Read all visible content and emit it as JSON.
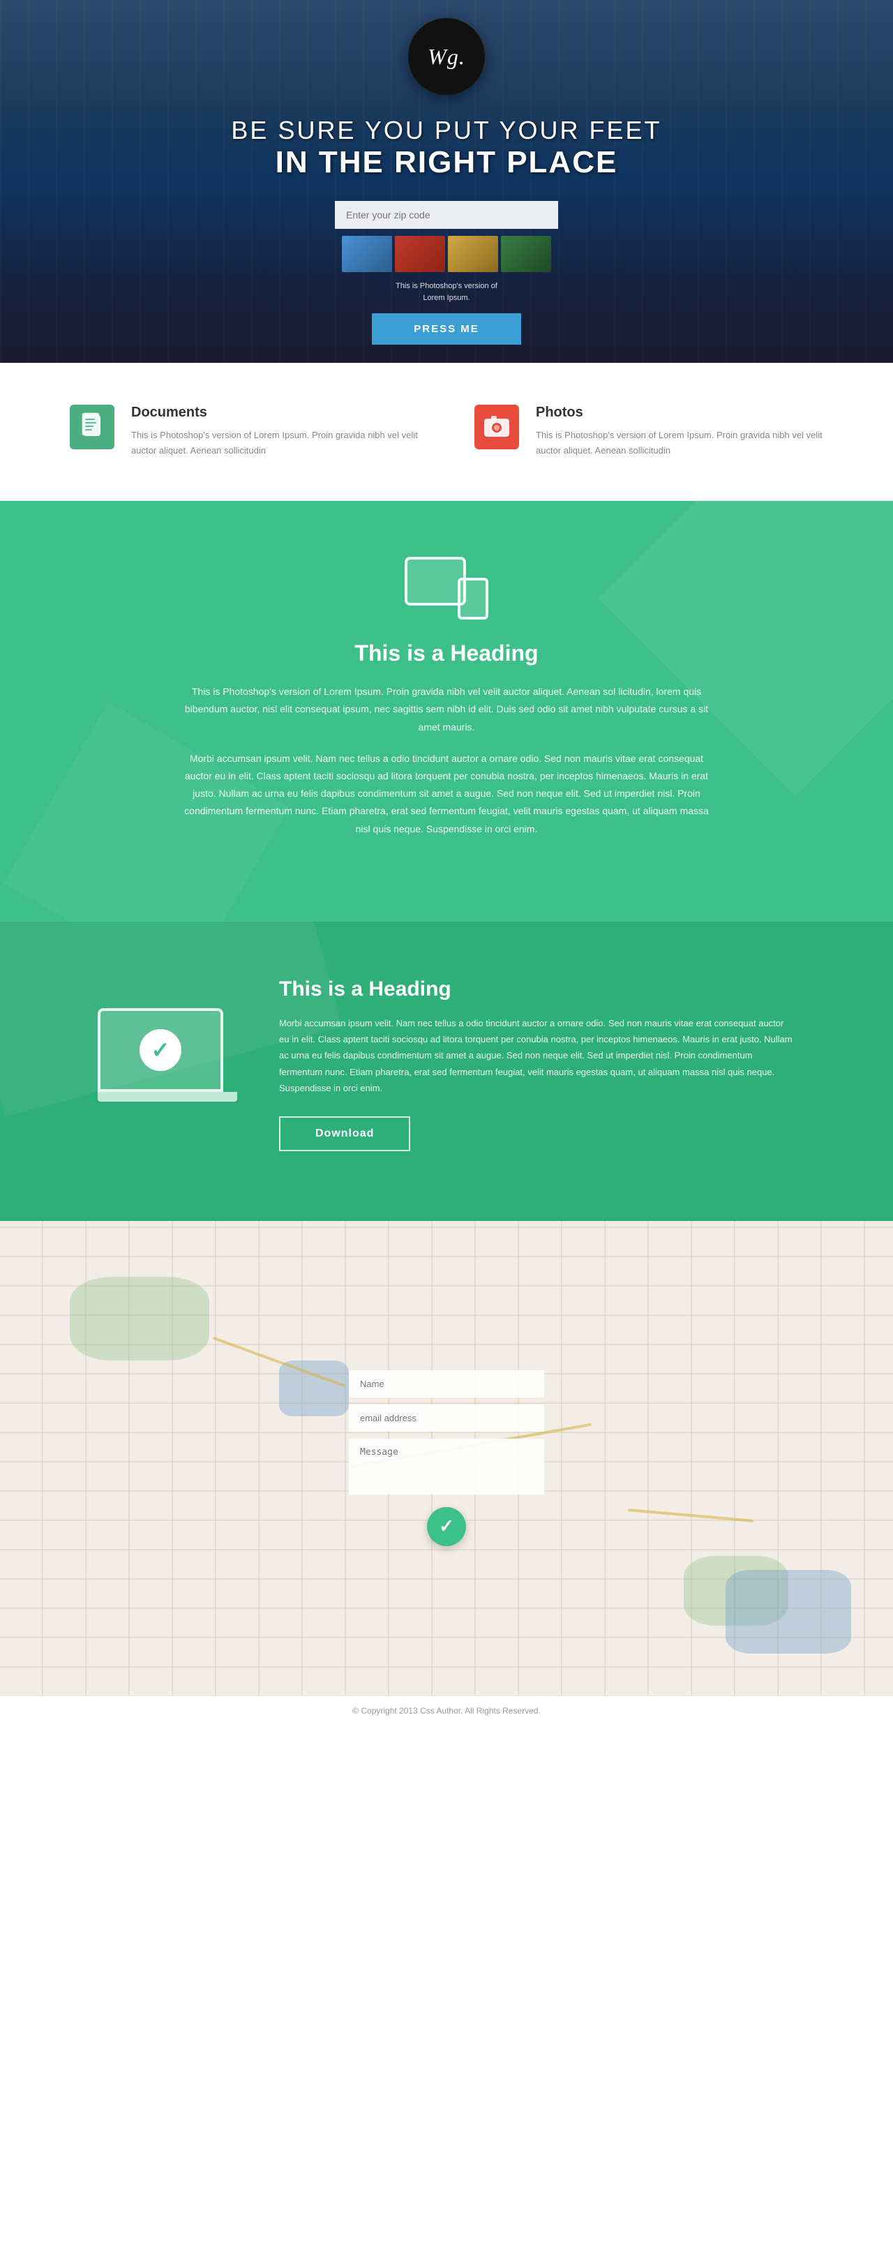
{
  "logo": {
    "text": "Wg.",
    "alt": "Wg Logo"
  },
  "hero": {
    "line1": "BE SURE YOU PUT YOUR FEET",
    "line2": "IN THE RIGHT PLACE",
    "input_placeholder": "Enter your zip code",
    "caption_line1": "This is Photoshop's version  of",
    "caption_line2": "Lorem Ipsum.",
    "button_label": "PRESS ME"
  },
  "features": {
    "items": [
      {
        "id": "documents",
        "title": "Documents",
        "icon": "📄",
        "description": "This is Photoshop's version  of Lorem Ipsum. Proin gravida nibh vel velit auctor aliquet. Aenean sollicitudin"
      },
      {
        "id": "photos",
        "title": "Photos",
        "icon": "📷",
        "description": "This is Photoshop's version  of Lorem Ipsum. Proin gravida nibh vel velit auctor aliquet. Aenean sollicitudin"
      }
    ]
  },
  "green_section_1": {
    "heading": "This is a Heading",
    "paragraph1": "This is Photoshop's version  of Lorem Ipsum. Proin gravida nibh vel velit auctor aliquet. Aenean sol licitudin, lorem quis bibendum auctor, nisl elit consequat ipsum, nec sagittis sem nibh id elit. Duis sed odio sit amet nibh vulputate cursus a sit amet mauris.",
    "paragraph2": "Morbi accumsan ipsum velit. Nam nec tellus a odio tincidunt auctor a ornare odio. Sed non  mauris vitae erat consequat auctor eu in elit. Class aptent taciti sociosqu ad litora torquent per conubia nostra, per inceptos himenaeos. Mauris in erat justo. Nullam ac urna eu felis dapibus condimentum sit amet a augue. Sed non neque elit. Sed ut imperdiet nisl. Proin condimentum fermentum nunc. Etiam pharetra, erat sed fermentum feugiat, velit mauris egestas quam, ut aliquam massa nisl quis neque. Suspendisse in orci enim."
  },
  "green_section_2": {
    "heading": "This is a Heading",
    "paragraph": "Morbi accumsan ipsum velit. Nam nec tellus a odio tincidunt auctor a ornare odio. Sed non  mauris vitae erat consequat auctor eu in elit. Class aptent taciti sociosqu ad litora torquent per conubia nostra, per inceptos himenaeos. Mauris in erat justo. Nullam ac urna eu felis dapibus condimentum sit amet a augue. Sed non neque elit. Sed ut imperdiet nisl. Proin condimentum fermentum nunc. Etiam pharetra, erat sed fermentum feugiat, velit mauris egestas quam, ut aliquam massa nisl quis neque. Suspendisse in orci enim.",
    "download_button": "Download"
  },
  "map": {
    "name_placeholder": "Name",
    "email_placeholder": "email address",
    "message_placeholder": "Message"
  },
  "footer": {
    "copyright": "© Copyright 2013 Css Author. All Rights Reserved."
  }
}
